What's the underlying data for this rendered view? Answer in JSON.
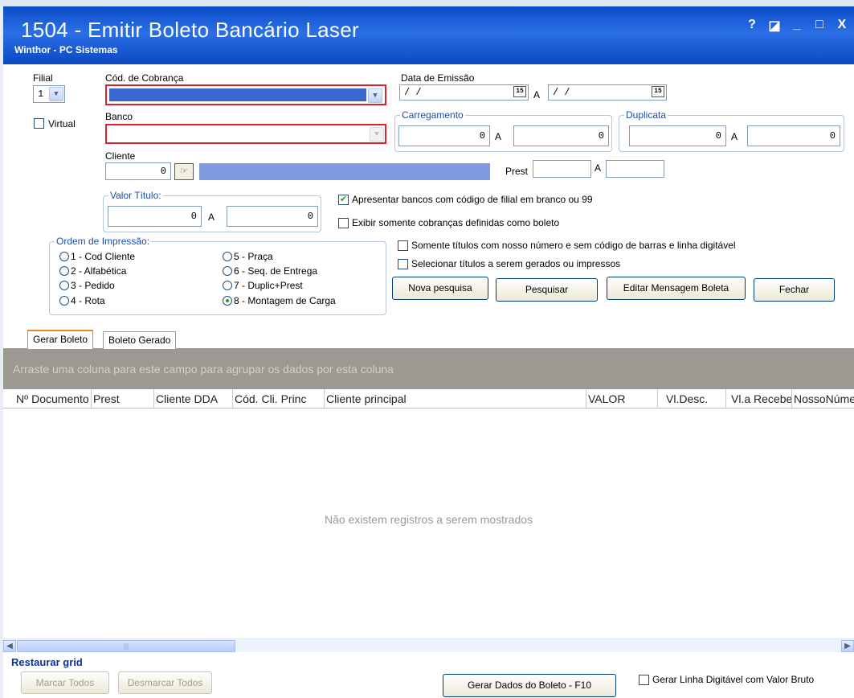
{
  "window": {
    "title": "1504 - Emitir Boleto Bancário Laser",
    "subtitle": "Winthor - PC Sistemas",
    "controls": [
      "?",
      "◪",
      "_",
      "□",
      "X"
    ]
  },
  "filter": {
    "filial_label": "Filial",
    "filial_value": "1",
    "virtual_label": "Virtual",
    "cod_cobranca_label": "Cód. de Cobrança",
    "banco_label": "Banco",
    "cliente_label": "Cliente",
    "cliente_value": "0",
    "prest_label": "Prest",
    "a_label": "A",
    "data_emissao_label": "Data de Emissão",
    "data_emissao_from": "/ /",
    "data_emissao_to": "/ /",
    "calendar_icon": "15",
    "carregamento_label": "Carregamento",
    "carregamento_from": "0",
    "carregamento_to": "0",
    "duplicata_label": "Duplicata",
    "duplicata_from": "0",
    "duplicata_to": "0",
    "valor_titulo_label": "Valor Título:",
    "valor_from": "0",
    "valor_to": "0"
  },
  "options": {
    "apresentar_bancos": "Apresentar bancos com código de filial em branco ou 99",
    "apresentar_bancos_checked": true,
    "exibir_somente": "Exibir somente cobranças definidas como boleto",
    "somente_titulos": "Somente títulos com nosso número e sem código de barras e linha digitável",
    "selecionar_titulos": "Selecionar títulos a serem gerados ou impressos",
    "check_mark": "✔"
  },
  "ordem": {
    "title": "Ordem de Impressão:",
    "items": [
      "1 - Cod Cliente",
      "2 - Alfabética",
      "3 - Pedido",
      "4 - Rota",
      "5 - Praça",
      "6 - Seq. de Entrega",
      "7 - Duplic+Prest",
      "8 - Montagem de Carga"
    ],
    "selected": "8 - Montagem de Carga"
  },
  "buttons": {
    "nova_pesquisa": "Nova pesquisa",
    "pesquisar": "Pesquisar",
    "editar_mensagem": "Editar Mensagem Boleta",
    "fechar": "Fechar"
  },
  "tabs": [
    "Gerar Boleto",
    "Boleto Gerado"
  ],
  "grid": {
    "group_hint": "Arraste uma coluna para este campo para agrupar os dados por esta coluna",
    "columns": [
      "Nº Documento",
      "Prest",
      "Cliente DDA",
      "Cód. Cli. Princ",
      "Cliente principal",
      "VALOR",
      "Vl.Desc.",
      "Vl.a Receber",
      "NossoNúmero"
    ],
    "empty_message": "Não existem registros a serem mostrados"
  },
  "footer": {
    "restaurar_grid": "Restaurar grid",
    "marcar_todos": "Marcar Todos",
    "desmarcar_todos": "Desmarcar Todos",
    "gerar_dados": "Gerar Dados do Boleto - F10",
    "gerar_linha": "Gerar Linha Digitável com Valor Bruto"
  },
  "colors": {
    "title_blue": "#0a4cc9",
    "required_red": "#e0202a",
    "selected_blue": "#3a6ad0",
    "group_header_gray": "#9b9991"
  },
  "icons": [
    "dropdown-arrow-icon",
    "calendar-icon",
    "search-client-icon",
    "scroll-left-icon",
    "scroll-right-icon"
  ]
}
